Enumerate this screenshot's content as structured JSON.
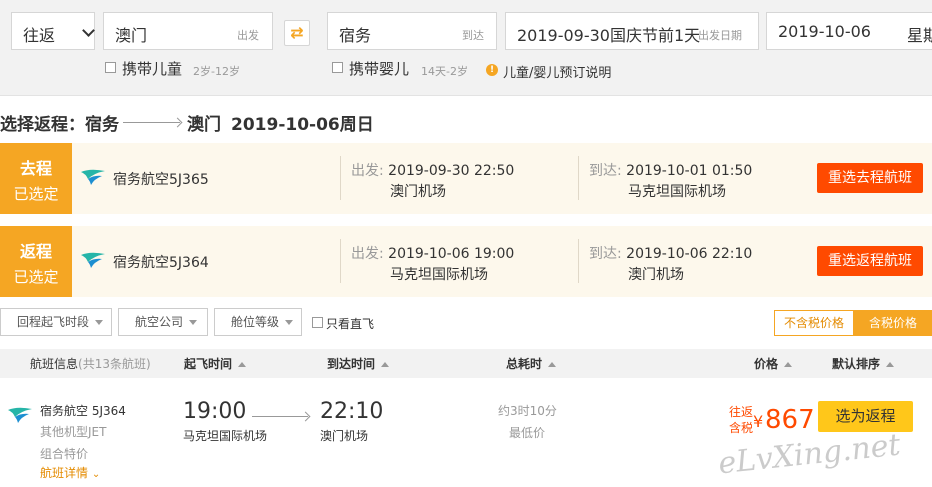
{
  "search": {
    "trip_type": "往返",
    "origin": {
      "city": "澳门",
      "label": "出发"
    },
    "destination": {
      "city": "宿务",
      "label": "到达"
    },
    "depart_date": {
      "value": "2019-09-30",
      "note": "国庆节前1天",
      "label": "出发日期"
    },
    "return_date": {
      "value": "2019-10-06",
      "weekday": "星期"
    },
    "options": {
      "child": {
        "label": "携带儿童",
        "sub": "2岁-12岁"
      },
      "infant": {
        "label": "携带婴儿",
        "sub": "14天-2岁"
      },
      "info": "儿童/婴儿预订说明"
    }
  },
  "heading": {
    "prefix": "选择返程：宿务",
    "dest": "澳门",
    "date": "2019-10-06周日"
  },
  "legs": [
    {
      "tag": "去程",
      "status": "已选定",
      "airline": "宿务航空5J365",
      "depart_label": "出发:",
      "depart_time": "2019-09-30 22:50",
      "depart_airport": "澳门机场",
      "arrive_label": "到达:",
      "arrive_time": "2019-10-01 01:50",
      "arrive_airport": "马克坦国际机场",
      "button": "重选去程航班"
    },
    {
      "tag": "返程",
      "status": "已选定",
      "airline": "宿务航空5J364",
      "depart_label": "出发:",
      "depart_time": "2019-10-06 19:00",
      "depart_airport": "马克坦国际机场",
      "arrive_label": "到达:",
      "arrive_time": "2019-10-06 22:10",
      "arrive_airport": "澳门机场",
      "button": "重选返程航班"
    }
  ],
  "filters": {
    "time": "回程起飞时段",
    "airline": "航空公司",
    "cabin": "舱位等级",
    "direct": "只看直飞",
    "price_excl": "不含税价格",
    "price_incl": "含税价格"
  },
  "table_header": {
    "info": "航班信息",
    "count": "(共13条航班)",
    "dep": "起飞时间",
    "arr": "到达时间",
    "duration": "总耗时",
    "price": "价格",
    "sort": "默认排序"
  },
  "flight": {
    "airline": "宿务航空 5J364",
    "aircraft": "其他机型JET",
    "promo": "组合特价",
    "details": "航班详情",
    "dep_time": "19:00",
    "dep_airport": "马克坦国际机场",
    "arr_time": "22:10",
    "arr_airport": "澳门机场",
    "duration": "约3时10分",
    "lowest": "最低价",
    "price_tag1": "往返",
    "price_tag2": "含税",
    "currency": "¥",
    "price": "867",
    "select": "选为返程"
  },
  "watermark": "eLvXing.net",
  "colors": {
    "accent": "#f5a623",
    "action": "#ff4a00",
    "price": "#ff4a00"
  }
}
